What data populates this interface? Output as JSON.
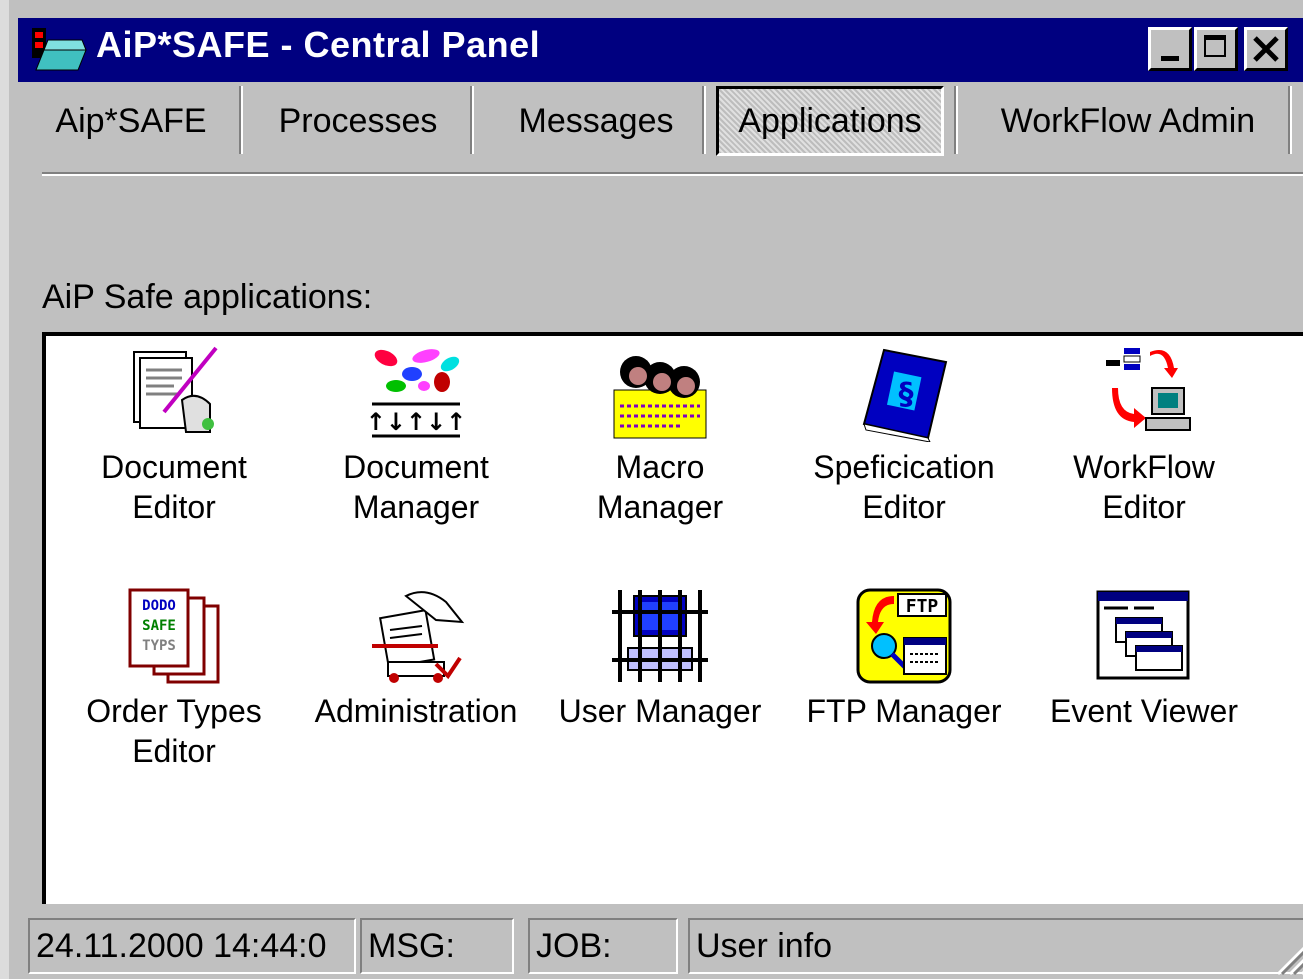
{
  "window": {
    "title": "AiP*SAFE - Central Panel"
  },
  "menu": {
    "items": [
      "Aip*SAFE",
      "Processes",
      "Messages",
      "Applications",
      "WorkFlow Admin"
    ]
  },
  "section": {
    "label": "AiP Safe applications:"
  },
  "apps": [
    {
      "line1": "Document",
      "line2": "Editor",
      "icon": "document-editor-icon"
    },
    {
      "line1": "Document",
      "line2": "Manager",
      "icon": "document-manager-icon"
    },
    {
      "line1": "Macro",
      "line2": "Manager",
      "icon": "macro-manager-icon"
    },
    {
      "line1": "Speficication",
      "line2": "Editor",
      "icon": "specification-editor-icon"
    },
    {
      "line1": "WorkFlow",
      "line2": "Editor",
      "icon": "workflow-editor-icon"
    },
    {
      "line1": "Order Types",
      "line2": "Editor",
      "icon": "order-types-editor-icon"
    },
    {
      "line1": "Administration",
      "line2": "",
      "icon": "administration-icon"
    },
    {
      "line1": "User Manager",
      "line2": "",
      "icon": "user-manager-icon"
    },
    {
      "line1": "FTP Manager",
      "line2": "",
      "icon": "ftp-manager-icon"
    },
    {
      "line1": "Event Viewer",
      "line2": "",
      "icon": "event-viewer-icon"
    }
  ],
  "icon_text": {
    "order_types": [
      "DODO",
      "SAFE",
      "TYPS"
    ],
    "ftp": "FTP",
    "spec": "§",
    "arrows": "↑↓↑↓↑"
  },
  "status": {
    "datetime": "24.11.2000 14:44:0",
    "msg": "MSG:",
    "job": "JOB:",
    "user_info": "User info"
  },
  "colors": {
    "titlebar": "#000080",
    "face": "#c0c0c0"
  }
}
